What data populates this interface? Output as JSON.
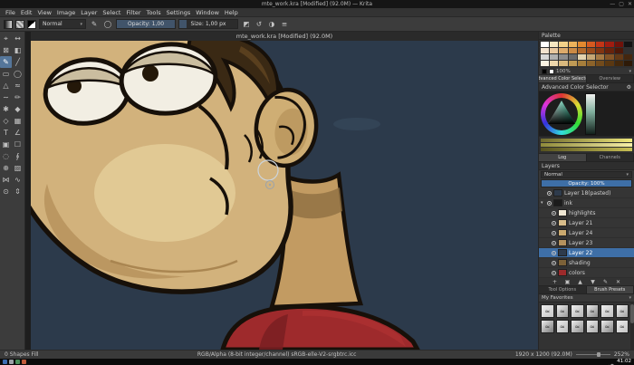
{
  "window": {
    "title": "mte_work.kra [Modified] (92.0M) — Krita",
    "controls": {
      "minimize": "—",
      "maximize": "▢",
      "close": "✕"
    }
  },
  "glyphs": {
    "caret": "▾",
    "gear": "⚙",
    "stroke": "≈"
  },
  "menu_bar": {
    "items": [
      "File",
      "Edit",
      "View",
      "Image",
      "Layer",
      "Select",
      "Filter",
      "Tools",
      "Settings",
      "Window",
      "Help"
    ]
  },
  "toolbar": {
    "blend_mode": "Normal",
    "opacity": {
      "label": "Opacity:",
      "value": "1,00"
    },
    "size": {
      "label": "Size:",
      "value": "1,00 px"
    },
    "icons": [
      {
        "name": "eraser-icon",
        "glyph": "◩"
      },
      {
        "name": "reload-icon",
        "glyph": "↺"
      },
      {
        "name": "mirror-icon",
        "glyph": "◑"
      },
      {
        "name": "options-icon",
        "glyph": "≡"
      }
    ]
  },
  "toolbox": {
    "tools": [
      {
        "name": "transform-tool",
        "glyph": "⌖"
      },
      {
        "name": "move-tool",
        "glyph": "↔"
      },
      {
        "name": "crop-tool",
        "glyph": "⊠"
      },
      {
        "name": "gradient-tool",
        "glyph": "◧"
      },
      {
        "name": "freehand-brush-tool",
        "glyph": "✎",
        "active": true
      },
      {
        "name": "line-tool",
        "glyph": "╱"
      },
      {
        "name": "rectangle-tool",
        "glyph": "▭"
      },
      {
        "name": "ellipse-tool",
        "glyph": "◯"
      },
      {
        "name": "polygon-tool",
        "glyph": "△"
      },
      {
        "name": "polyline-tool",
        "glyph": "≈"
      },
      {
        "name": "bezier-curve-tool",
        "glyph": "∼"
      },
      {
        "name": "dynamic-brush-tool",
        "glyph": "✏"
      },
      {
        "name": "multibrush-tool",
        "glyph": "✱"
      },
      {
        "name": "fill-tool",
        "glyph": "◆"
      },
      {
        "name": "color-sampler-tool",
        "glyph": "◇"
      },
      {
        "name": "pattern-edit-tool",
        "glyph": "▦"
      },
      {
        "name": "text-tool",
        "glyph": "T"
      },
      {
        "name": "assistant-tool",
        "glyph": "∠"
      },
      {
        "name": "reference-images-tool",
        "glyph": "▣"
      },
      {
        "name": "rectangular-select-tool",
        "glyph": "☐"
      },
      {
        "name": "elliptical-select-tool",
        "glyph": "◌"
      },
      {
        "name": "freehand-select-tool",
        "glyph": "∮"
      },
      {
        "name": "similar-color-select-tool",
        "glyph": "⊕"
      },
      {
        "name": "contiguous-select-tool",
        "glyph": "▨"
      },
      {
        "name": "magnetic-select-tool",
        "glyph": "⋈"
      },
      {
        "name": "bezier-select-tool",
        "glyph": "∿"
      },
      {
        "name": "zoom-tool",
        "glyph": "⊙"
      },
      {
        "name": "pan-tool",
        "glyph": "⇕"
      }
    ]
  },
  "canvas": {
    "tab_title": "mte_work.kra [Modified] (92.0M)"
  },
  "palette": {
    "title": "Palette",
    "scale": "100%",
    "colors": [
      "#ffffff",
      "#f6e7c1",
      "#f2d189",
      "#ecb25b",
      "#e2892f",
      "#d55a20",
      "#c23517",
      "#a01c10",
      "#70120a",
      "#141414",
      "#f3e3cf",
      "#e9c89e",
      "#dcaa6b",
      "#cb8a45",
      "#b36a2c",
      "#9a4c1c",
      "#823512",
      "#68230c",
      "#4e1808",
      "#303030",
      "#d8d8d8",
      "#b0b0b0",
      "#8c8c8c",
      "#6a6a6a",
      "#e4d3ae",
      "#c6a775",
      "#a67943",
      "#855426",
      "#643916",
      "#44260e",
      "#fbf3e2",
      "#eed7ab",
      "#d9b97e",
      "#bf9a55",
      "#a67e3b",
      "#8c632a",
      "#724b1c",
      "#5a3812",
      "#43280c",
      "#2e1a08"
    ]
  },
  "selector": {
    "tabs": [
      "Advanced Color Selector",
      "Overview"
    ],
    "active": 0,
    "header": "Advanced Color Selector",
    "shade_rows": [
      [
        "#6f6a2e",
        "#efe87c"
      ],
      [
        "#8f8a3a",
        "#f7f0a8"
      ],
      [
        "#55511f",
        "#c9c055"
      ]
    ]
  },
  "channels": {
    "tabs": [
      "Log",
      "Channels"
    ],
    "active": 0
  },
  "layers": {
    "title": "Layers",
    "blend_mode": "Normal",
    "opacity_label": "Opacity:",
    "opacity_value": "100%",
    "rows": [
      {
        "name": "Layer 18(pasted)",
        "indent": 0,
        "thumb": "#2e3b4c",
        "selected": false,
        "group": false
      },
      {
        "name": "ink",
        "indent": 0,
        "thumb": "#1b1b1b",
        "selected": false,
        "group": true
      },
      {
        "name": "highlights",
        "indent": 1,
        "thumb": "#efe7d4",
        "selected": false,
        "group": false
      },
      {
        "name": "Layer 21",
        "indent": 1,
        "thumb": "#d8bd8b",
        "selected": false,
        "group": false
      },
      {
        "name": "Layer 24",
        "indent": 1,
        "thumb": "#caa96f",
        "selected": false,
        "group": false
      },
      {
        "name": "Layer 23",
        "indent": 1,
        "thumb": "#b5925e",
        "selected": false,
        "group": false
      },
      {
        "name": "Layer 22",
        "indent": 1,
        "thumb": "#2e3b4c",
        "selected": true,
        "group": false
      },
      {
        "name": "shading",
        "indent": 1,
        "thumb": "#7c6138",
        "selected": false,
        "group": false
      },
      {
        "name": "colors",
        "indent": 1,
        "thumb": "#9c2a2b",
        "selected": false,
        "group": false
      }
    ],
    "buttons": [
      {
        "name": "add-layer-button",
        "glyph": "+"
      },
      {
        "name": "duplicate-layer-button",
        "glyph": "▣"
      },
      {
        "name": "move-layer-up-button",
        "glyph": "▲"
      },
      {
        "name": "move-layer-down-button",
        "glyph": "▼"
      },
      {
        "name": "layer-properties-button",
        "glyph": "✎"
      },
      {
        "name": "delete-layer-button",
        "glyph": "✕"
      }
    ]
  },
  "tool_panel": {
    "tabs": [
      "Tool Options",
      "Brush Presets"
    ],
    "active": 1,
    "favorites_label": "My Favorites"
  },
  "brushes": {
    "items": [
      "#c9c9c9",
      "#9a9a9a",
      "#b5b5b5",
      "#8a8a8a",
      "#c0c0c0",
      "#a5a5a5",
      "#7a7a7a",
      "#bdbdbd",
      "#909090",
      "#adadad",
      "#858585",
      "#c5c5c5"
    ]
  },
  "status_bar": {
    "selection": "0 Shapes Fill",
    "profile": "RGB/Alpha (8-bit integer/channel)  sRGB-elle-V2-srgbtrc.icc",
    "size": "1920 x 1200 (92.0M)",
    "zoom": "252%"
  },
  "taskbar": {
    "clock": "41:02",
    "launchers": [
      "#3c6db2",
      "#9aa0a6",
      "#4a8f5a",
      "#c05a3a"
    ],
    "tray": [
      "▴",
      "●"
    ]
  }
}
